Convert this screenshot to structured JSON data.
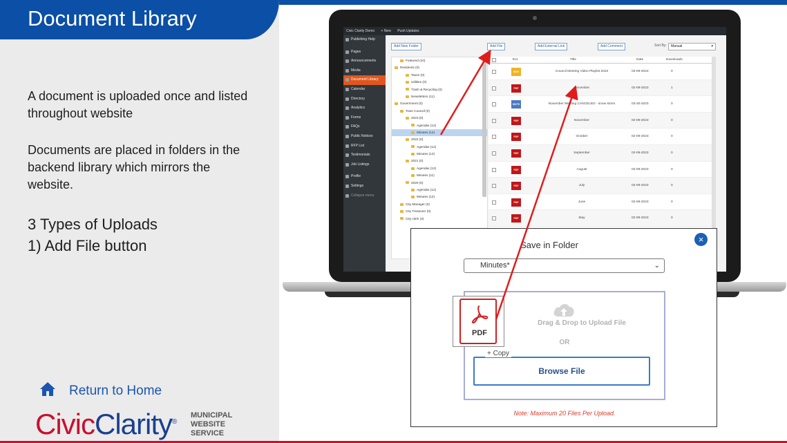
{
  "slide": {
    "title": "Document Library",
    "paragraph1": "A document is uploaded once and listed throughout website",
    "paragraph2": "Documents are placed in folders in the backend library which mirrors the website.",
    "types_line1": "3 Types of Uploads",
    "types_line2": "1) Add File button",
    "home_link": "Return to Home",
    "logo_civic": "Civic",
    "logo_clarity": "Clarity",
    "logo_reg": "®",
    "tagline": [
      "MUNICIPAL",
      "WEBSITE",
      "SERVICE"
    ]
  },
  "admin_bar": [
    "Civic Clarity Demo",
    "+ New",
    "Push Updates"
  ],
  "sidebar": [
    {
      "label": "Publishing Help"
    },
    {
      "label": "Pages"
    },
    {
      "label": "Announcements"
    },
    {
      "label": "Media"
    },
    {
      "label": "Document Library",
      "active": true
    },
    {
      "label": "Calendar"
    },
    {
      "label": "Directory"
    },
    {
      "label": "Analytics"
    },
    {
      "label": "Forms"
    },
    {
      "label": "FAQs"
    },
    {
      "label": "Public Notices"
    },
    {
      "label": "RFP List"
    },
    {
      "label": "Testimonials"
    },
    {
      "label": "Job Listings"
    },
    {
      "label": "Profile"
    },
    {
      "label": "Settings"
    },
    {
      "label": "Collapse menu",
      "dim": true
    }
  ],
  "toolbar": {
    "add_folder": "Add New Folder",
    "add_file": "Add File",
    "add_link": "Add External Link",
    "add_comment": "Add Comment",
    "sort_label": "Sort By:",
    "sort_value": "Manual"
  },
  "tree": [
    {
      "label": "Featured (10)",
      "indent": 1
    },
    {
      "label": "Residents (0)",
      "indent": 0
    },
    {
      "label": "Taxes (0)",
      "indent": 2
    },
    {
      "label": "Utilities (0)",
      "indent": 2
    },
    {
      "label": "Trash & Recycling (0)",
      "indent": 2
    },
    {
      "label": "Newsletters (11)",
      "indent": 2
    },
    {
      "label": "Government (0)",
      "indent": 0
    },
    {
      "label": "Town Council (0)",
      "indent": 1
    },
    {
      "label": "2023 (0)",
      "indent": 2
    },
    {
      "label": "Agendas (12)",
      "indent": 3
    },
    {
      "label": "Minutes (14)",
      "indent": 3,
      "selected": true
    },
    {
      "label": "2022 (0)",
      "indent": 2
    },
    {
      "label": "Agendas (12)",
      "indent": 3
    },
    {
      "label": "Minutes (13)",
      "indent": 3
    },
    {
      "label": "2021 (0)",
      "indent": 2
    },
    {
      "label": "Agendas (12)",
      "indent": 3
    },
    {
      "label": "Minutes (11)",
      "indent": 3
    },
    {
      "label": "2020 (0)",
      "indent": 2
    },
    {
      "label": "Agendas (12)",
      "indent": 3
    },
    {
      "label": "Minutes (12)",
      "indent": 3
    },
    {
      "label": "City Manager (0)",
      "indent": 1
    },
    {
      "label": "City Treasurer (0)",
      "indent": 1
    },
    {
      "label": "City clerk (3)",
      "indent": 1
    }
  ],
  "table": {
    "headers": {
      "ext": "Ext",
      "title": "Title",
      "date": "Date",
      "downloads": "Downloads"
    },
    "rows": [
      {
        "ext": "MOV",
        "ext_color": "#f0b323",
        "title": "Council Meeting Video Playlist 2023",
        "date": "03-09-2023",
        "downloads": "0"
      },
      {
        "ext": "PDF",
        "ext_color": "#c0161a",
        "title": "December",
        "date": "02-09-2023",
        "downloads": "1"
      },
      {
        "ext": "MOTS",
        "ext_color": "#4a78c2",
        "title": "November Meeting CANCELED - snow storm",
        "date": "03-30-2023",
        "downloads": "0"
      },
      {
        "ext": "PDF",
        "ext_color": "#c0161a",
        "title": "November",
        "date": "02-09-2023",
        "downloads": "0"
      },
      {
        "ext": "PDF",
        "ext_color": "#c0161a",
        "title": "October",
        "date": "02-09-2023",
        "downloads": "0"
      },
      {
        "ext": "PDF",
        "ext_color": "#c0161a",
        "title": "September",
        "date": "02-09-2023",
        "downloads": "0"
      },
      {
        "ext": "PDF",
        "ext_color": "#c0161a",
        "title": "August",
        "date": "02-09-2023",
        "downloads": "0"
      },
      {
        "ext": "PDF",
        "ext_color": "#c0161a",
        "title": "July",
        "date": "02-09-2023",
        "downloads": "0"
      },
      {
        "ext": "PDF",
        "ext_color": "#c0161a",
        "title": "June",
        "date": "02-09-2023",
        "downloads": "0"
      },
      {
        "ext": "PDF",
        "ext_color": "#c0161a",
        "title": "May",
        "date": "02-09-2023",
        "downloads": "0"
      }
    ]
  },
  "dialog": {
    "title": "Save in Folder",
    "close": "×",
    "folder_value": "Minutes*",
    "drag_text": "Drag & Drop to Upload File",
    "or_text": "OR",
    "browse": "Browse File",
    "copy_label": "+ Copy",
    "note": "Note: Maximum 20 Files Per Upload.",
    "pdf_label": "PDF"
  },
  "colors": {
    "brand_blue": "#0b4fa6",
    "brand_red": "#c8102e",
    "wp_active": "#e1561e",
    "arrow": "#e01c1c"
  }
}
